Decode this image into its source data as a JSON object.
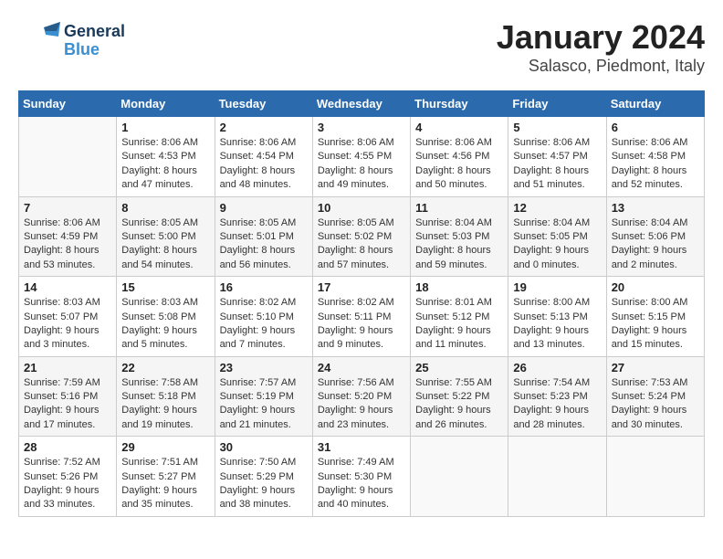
{
  "logo": {
    "line1": "General",
    "line2": "Blue"
  },
  "title": "January 2024",
  "subtitle": "Salasco, Piedmont, Italy",
  "days_of_week": [
    "Sunday",
    "Monday",
    "Tuesday",
    "Wednesday",
    "Thursday",
    "Friday",
    "Saturday"
  ],
  "weeks": [
    [
      {
        "day": "",
        "sunrise": "",
        "sunset": "",
        "daylight": ""
      },
      {
        "day": "1",
        "sunrise": "Sunrise: 8:06 AM",
        "sunset": "Sunset: 4:53 PM",
        "daylight": "Daylight: 8 hours and 47 minutes."
      },
      {
        "day": "2",
        "sunrise": "Sunrise: 8:06 AM",
        "sunset": "Sunset: 4:54 PM",
        "daylight": "Daylight: 8 hours and 48 minutes."
      },
      {
        "day": "3",
        "sunrise": "Sunrise: 8:06 AM",
        "sunset": "Sunset: 4:55 PM",
        "daylight": "Daylight: 8 hours and 49 minutes."
      },
      {
        "day": "4",
        "sunrise": "Sunrise: 8:06 AM",
        "sunset": "Sunset: 4:56 PM",
        "daylight": "Daylight: 8 hours and 50 minutes."
      },
      {
        "day": "5",
        "sunrise": "Sunrise: 8:06 AM",
        "sunset": "Sunset: 4:57 PM",
        "daylight": "Daylight: 8 hours and 51 minutes."
      },
      {
        "day": "6",
        "sunrise": "Sunrise: 8:06 AM",
        "sunset": "Sunset: 4:58 PM",
        "daylight": "Daylight: 8 hours and 52 minutes."
      }
    ],
    [
      {
        "day": "7",
        "sunrise": "Sunrise: 8:06 AM",
        "sunset": "Sunset: 4:59 PM",
        "daylight": "Daylight: 8 hours and 53 minutes."
      },
      {
        "day": "8",
        "sunrise": "Sunrise: 8:05 AM",
        "sunset": "Sunset: 5:00 PM",
        "daylight": "Daylight: 8 hours and 54 minutes."
      },
      {
        "day": "9",
        "sunrise": "Sunrise: 8:05 AM",
        "sunset": "Sunset: 5:01 PM",
        "daylight": "Daylight: 8 hours and 56 minutes."
      },
      {
        "day": "10",
        "sunrise": "Sunrise: 8:05 AM",
        "sunset": "Sunset: 5:02 PM",
        "daylight": "Daylight: 8 hours and 57 minutes."
      },
      {
        "day": "11",
        "sunrise": "Sunrise: 8:04 AM",
        "sunset": "Sunset: 5:03 PM",
        "daylight": "Daylight: 8 hours and 59 minutes."
      },
      {
        "day": "12",
        "sunrise": "Sunrise: 8:04 AM",
        "sunset": "Sunset: 5:05 PM",
        "daylight": "Daylight: 9 hours and 0 minutes."
      },
      {
        "day": "13",
        "sunrise": "Sunrise: 8:04 AM",
        "sunset": "Sunset: 5:06 PM",
        "daylight": "Daylight: 9 hours and 2 minutes."
      }
    ],
    [
      {
        "day": "14",
        "sunrise": "Sunrise: 8:03 AM",
        "sunset": "Sunset: 5:07 PM",
        "daylight": "Daylight: 9 hours and 3 minutes."
      },
      {
        "day": "15",
        "sunrise": "Sunrise: 8:03 AM",
        "sunset": "Sunset: 5:08 PM",
        "daylight": "Daylight: 9 hours and 5 minutes."
      },
      {
        "day": "16",
        "sunrise": "Sunrise: 8:02 AM",
        "sunset": "Sunset: 5:10 PM",
        "daylight": "Daylight: 9 hours and 7 minutes."
      },
      {
        "day": "17",
        "sunrise": "Sunrise: 8:02 AM",
        "sunset": "Sunset: 5:11 PM",
        "daylight": "Daylight: 9 hours and 9 minutes."
      },
      {
        "day": "18",
        "sunrise": "Sunrise: 8:01 AM",
        "sunset": "Sunset: 5:12 PM",
        "daylight": "Daylight: 9 hours and 11 minutes."
      },
      {
        "day": "19",
        "sunrise": "Sunrise: 8:00 AM",
        "sunset": "Sunset: 5:13 PM",
        "daylight": "Daylight: 9 hours and 13 minutes."
      },
      {
        "day": "20",
        "sunrise": "Sunrise: 8:00 AM",
        "sunset": "Sunset: 5:15 PM",
        "daylight": "Daylight: 9 hours and 15 minutes."
      }
    ],
    [
      {
        "day": "21",
        "sunrise": "Sunrise: 7:59 AM",
        "sunset": "Sunset: 5:16 PM",
        "daylight": "Daylight: 9 hours and 17 minutes."
      },
      {
        "day": "22",
        "sunrise": "Sunrise: 7:58 AM",
        "sunset": "Sunset: 5:18 PM",
        "daylight": "Daylight: 9 hours and 19 minutes."
      },
      {
        "day": "23",
        "sunrise": "Sunrise: 7:57 AM",
        "sunset": "Sunset: 5:19 PM",
        "daylight": "Daylight: 9 hours and 21 minutes."
      },
      {
        "day": "24",
        "sunrise": "Sunrise: 7:56 AM",
        "sunset": "Sunset: 5:20 PM",
        "daylight": "Daylight: 9 hours and 23 minutes."
      },
      {
        "day": "25",
        "sunrise": "Sunrise: 7:55 AM",
        "sunset": "Sunset: 5:22 PM",
        "daylight": "Daylight: 9 hours and 26 minutes."
      },
      {
        "day": "26",
        "sunrise": "Sunrise: 7:54 AM",
        "sunset": "Sunset: 5:23 PM",
        "daylight": "Daylight: 9 hours and 28 minutes."
      },
      {
        "day": "27",
        "sunrise": "Sunrise: 7:53 AM",
        "sunset": "Sunset: 5:24 PM",
        "daylight": "Daylight: 9 hours and 30 minutes."
      }
    ],
    [
      {
        "day": "28",
        "sunrise": "Sunrise: 7:52 AM",
        "sunset": "Sunset: 5:26 PM",
        "daylight": "Daylight: 9 hours and 33 minutes."
      },
      {
        "day": "29",
        "sunrise": "Sunrise: 7:51 AM",
        "sunset": "Sunset: 5:27 PM",
        "daylight": "Daylight: 9 hours and 35 minutes."
      },
      {
        "day": "30",
        "sunrise": "Sunrise: 7:50 AM",
        "sunset": "Sunset: 5:29 PM",
        "daylight": "Daylight: 9 hours and 38 minutes."
      },
      {
        "day": "31",
        "sunrise": "Sunrise: 7:49 AM",
        "sunset": "Sunset: 5:30 PM",
        "daylight": "Daylight: 9 hours and 40 minutes."
      },
      {
        "day": "",
        "sunrise": "",
        "sunset": "",
        "daylight": ""
      },
      {
        "day": "",
        "sunrise": "",
        "sunset": "",
        "daylight": ""
      },
      {
        "day": "",
        "sunrise": "",
        "sunset": "",
        "daylight": ""
      }
    ]
  ]
}
